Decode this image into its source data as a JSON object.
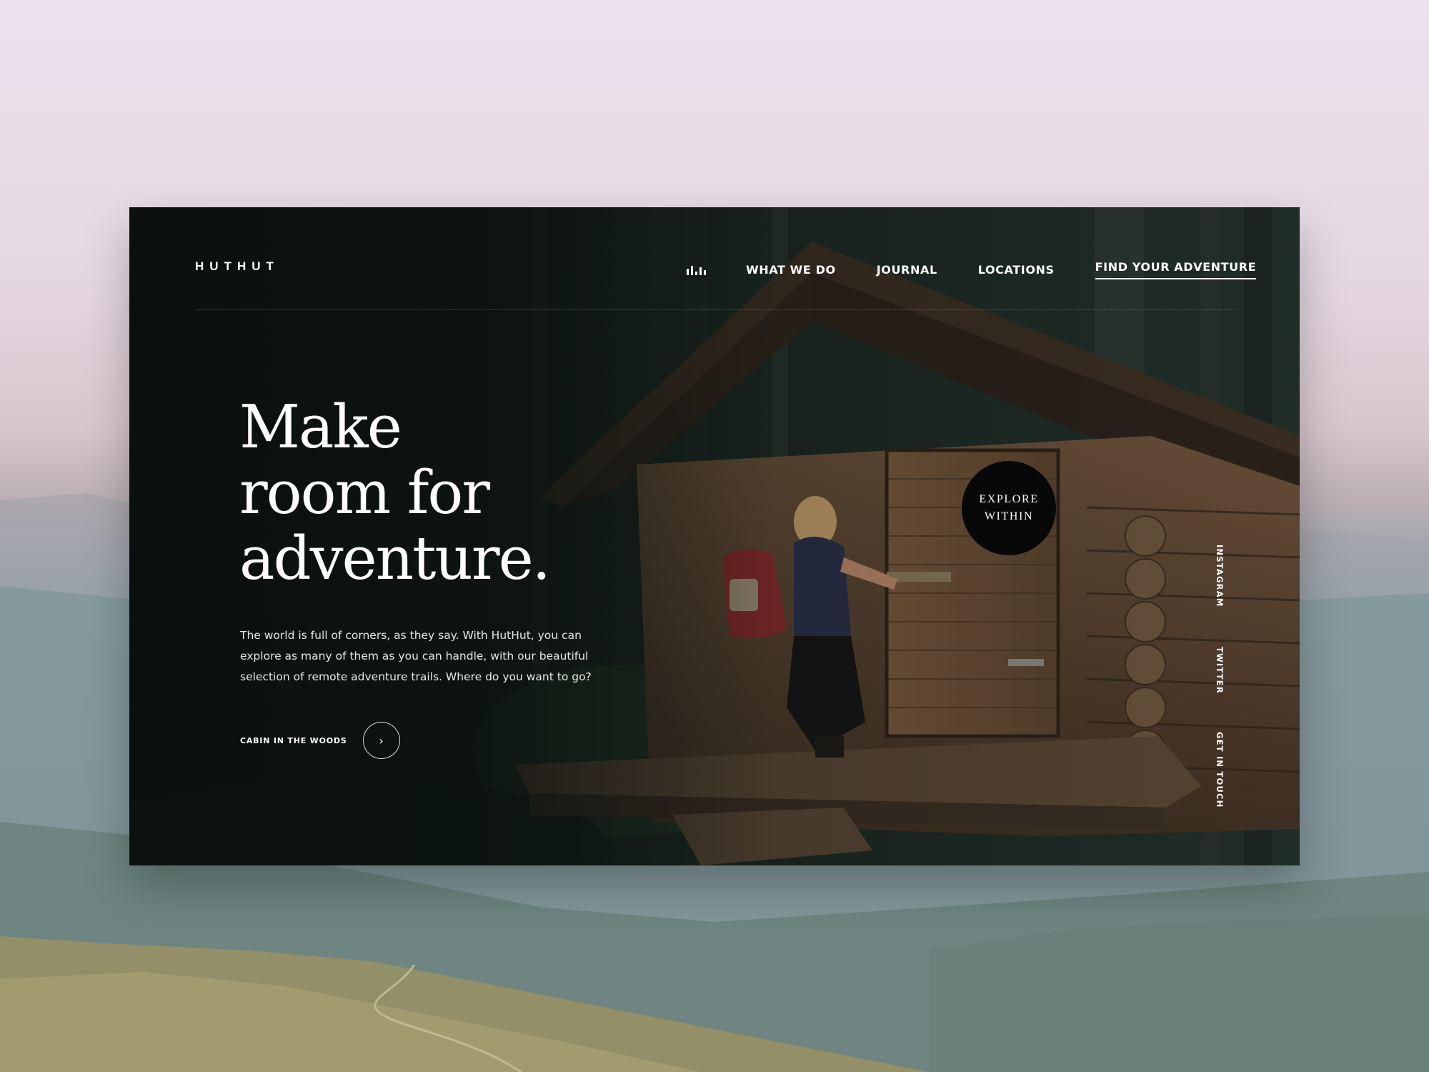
{
  "brand": {
    "logo": "HUTHUT"
  },
  "nav": {
    "icon": "bars-chart-icon",
    "items": [
      {
        "label": "WHAT WE DO"
      },
      {
        "label": "JOURNAL"
      },
      {
        "label": "LOCATIONS"
      },
      {
        "label": "FIND YOUR ADVENTURE",
        "active": true
      }
    ]
  },
  "hero": {
    "title_lines": [
      "Make",
      "room for",
      "adventure."
    ],
    "body": "The world is full of corners, as they say. With HutHut, you can explore as many of them as you can handle, with our beautiful selection of remote adventure trails. Where do you want to go?",
    "cta_label": "CABIN IN THE WOODS",
    "cta_icon": "chevron-right-icon"
  },
  "badge": {
    "lines": [
      "EXPLORE",
      "WITHIN"
    ]
  },
  "social": [
    {
      "label": "INSTAGRAM"
    },
    {
      "label": "TWITTER"
    },
    {
      "label": "GET IN TOUCH"
    }
  ],
  "colors": {
    "card_bg": "#121a17",
    "text": "#ffffff",
    "badge_bg": "#080808",
    "cabin_wood": "#5a4330",
    "backpack": "#8b2a2a"
  }
}
